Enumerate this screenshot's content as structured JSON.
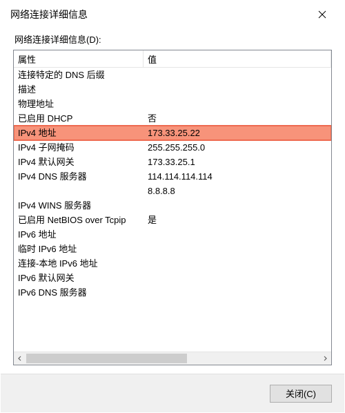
{
  "window": {
    "title": "网络连接详细信息"
  },
  "section_label": "网络连接详细信息(D):",
  "columns": {
    "property": "属性",
    "value": "值"
  },
  "rows": [
    {
      "prop": "连接特定的 DNS 后缀",
      "val": ""
    },
    {
      "prop": "描述",
      "val": ""
    },
    {
      "prop": "物理地址",
      "val": ""
    },
    {
      "prop": "已启用 DHCP",
      "val": "否"
    },
    {
      "prop": "IPv4 地址",
      "val": "173.33.25.22",
      "highlight": true
    },
    {
      "prop": "IPv4 子网掩码",
      "val": "255.255.255.0"
    },
    {
      "prop": "IPv4 默认网关",
      "val": "173.33.25.1"
    },
    {
      "prop": "IPv4 DNS 服务器",
      "val": "114.114.114.114"
    },
    {
      "prop": "",
      "val": "8.8.8.8"
    },
    {
      "prop": "IPv4 WINS 服务器",
      "val": ""
    },
    {
      "prop": "已启用 NetBIOS over Tcpip",
      "val": "是"
    },
    {
      "prop": "IPv6 地址",
      "val": ""
    },
    {
      "prop": "临时 IPv6 地址",
      "val": ""
    },
    {
      "prop": "连接-本地 IPv6 地址",
      "val": ""
    },
    {
      "prop": "IPv6 默认网关",
      "val": ""
    },
    {
      "prop": "IPv6 DNS 服务器",
      "val": ""
    }
  ],
  "footer": {
    "close_label": "关闭(C)"
  }
}
